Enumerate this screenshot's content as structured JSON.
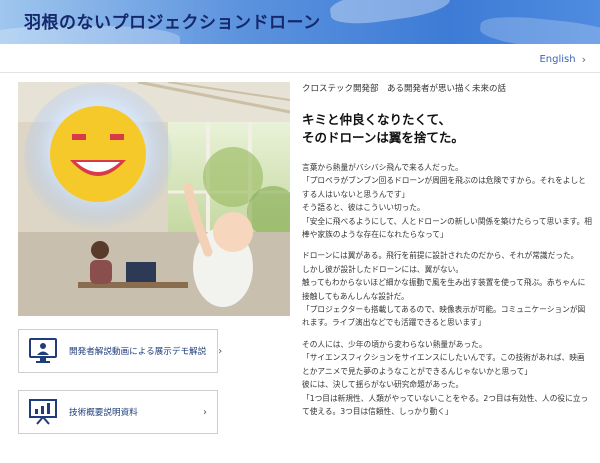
{
  "header": {
    "title": "羽根のないプロジェクションドローン"
  },
  "lang": {
    "label": "English",
    "chevron": "›"
  },
  "hero": {
    "alt_icon": "smiling-drone-illustration"
  },
  "cards": [
    {
      "label": "開発者解説動画による展示デモ解説",
      "icon": "monitor-presenter-icon",
      "chevron": "›"
    },
    {
      "label": "技術概要説明資料",
      "icon": "presentation-board-icon",
      "chevron": "›"
    }
  ],
  "article": {
    "kicker": "クロステック開発部　ある開発者が思い描く未来の話",
    "headline_line1": "キミと仲良くなりたくて、",
    "headline_line2": "そのドローンは翼を捨てた。",
    "paragraphs": [
      [
        "言葉から熱量がバシバシ飛んで来る人だった。",
        "「プロペラがブンブン回るドローンが周囲を飛ぶのは危険ですから。それをよしとする人はいないと思うんです」",
        "そう語ると、彼はこういい切った。",
        "「安全に飛べるようにして、人とドローンの新しい関係を築けたらって思います。相棒や家族のような存在になれたらなって」"
      ],
      [
        "ドローンには翼がある。飛行を前提に設計されたのだから、それが常識だった。",
        "しかし彼が設計したドローンには、翼がない。",
        "触ってもわからないほど細かな振動で風を生み出す装置を使って飛ぶ。赤ちゃんに接触してもあんしんな設計だ。",
        "「プロジェクターも搭載してあるので、映像表示が可能。コミュニケーションが図れます。ライブ演出などでも活躍できると思います」"
      ],
      [
        "その人には、少年の頃から変わらない熱量があった。",
        "「サイエンスフィクションをサイエンスにしたいんです。この技術があれば、映画とかアニメで見た夢のようなことができるんじゃないかと思って」",
        "彼には、決して揺らがない研究命題があった。",
        "「1つ目は新規性、人類がやっていないことをやる。2つ目は有効性、人の役に立って使える。3つ目は信頼性、しっかり動く」"
      ]
    ]
  }
}
